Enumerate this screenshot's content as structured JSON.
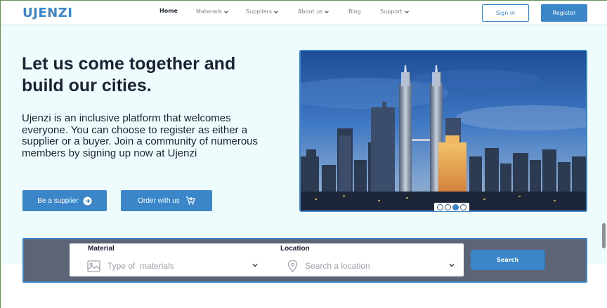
{
  "header": {
    "logo": "UJENZI",
    "nav": [
      {
        "label": "Home",
        "active": true,
        "dropdown": false
      },
      {
        "label": "Materials",
        "active": false,
        "dropdown": true
      },
      {
        "label": "Suppliers",
        "active": false,
        "dropdown": true
      },
      {
        "label": "About us",
        "active": false,
        "dropdown": true
      },
      {
        "label": "Blog",
        "active": false,
        "dropdown": false
      },
      {
        "label": "Support",
        "active": false,
        "dropdown": true
      }
    ],
    "signin_label": "Sign in",
    "register_label": "Register"
  },
  "hero": {
    "headline": "Let us come together and build our cities.",
    "description": "Ujenzi is an inclusive platform that welcomes everyone. You can choose to register as either a supplier or a buyer. Join a community of numerous members by signing up now at Ujenzi",
    "supplier_button": "Be a supplier",
    "order_button": "Order with us",
    "carousel": {
      "slides": 4,
      "active_index": 2
    }
  },
  "search": {
    "material_label": "Material",
    "material_placeholder": "Type of  materials",
    "location_label": "Location",
    "location_placeholder": "Search a location",
    "button_label": "Search"
  },
  "colors": {
    "brand": "#3a86c8",
    "hero_bg": "#eefcfd",
    "search_band": "#5d6475",
    "heading": "#1b2233"
  },
  "icons": {
    "supplier_button": "arrow-right-circle-icon",
    "order_button": "cart-icon",
    "material_field": "image-icon",
    "location_field": "location-pin-icon",
    "dropdown": "chevron-down-icon"
  }
}
